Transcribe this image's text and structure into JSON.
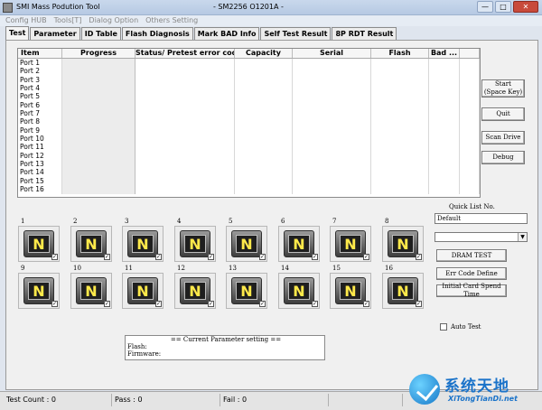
{
  "window": {
    "title": "SMI Mass Podution Tool",
    "center_title": "- SM2256 O1201A -",
    "minimize": "—",
    "maximize": "□",
    "close": "✕"
  },
  "menu": [
    "Config HUB",
    "Tools[T]",
    "Dialog Option",
    "Others Setting"
  ],
  "tabs": [
    "Test",
    "Parameter",
    "ID Table",
    "Flash Diagnosis",
    "Mark BAD Info",
    "Self Test Result",
    "8P RDT Result"
  ],
  "table": {
    "headers": [
      "Item",
      "Progress",
      "Status/ Pretest error code",
      "Capacity",
      "Serial",
      "Flash",
      "Bad ..."
    ],
    "rows": [
      "Port 1",
      "Port 2",
      "Port 3",
      "Port 4",
      "Port 5",
      "Port 6",
      "Port 7",
      "Port 8",
      "Port 9",
      "Port 10",
      "Port 11",
      "Port 12",
      "Port 13",
      "Port 14",
      "Port 15",
      "Port 16"
    ]
  },
  "buttons": {
    "start": "Start\n(Space Key)",
    "quit": "Quit",
    "scan_drive": "Scan Drive",
    "debug": "Debug",
    "dram_test": "DRAM TEST",
    "err_code_define": "Err Code Define",
    "initial_card_spend_time": "Initial Card Spend Time"
  },
  "ports": {
    "numbers": [
      "1",
      "2",
      "3",
      "4",
      "5",
      "6",
      "7",
      "8",
      "9",
      "10",
      "11",
      "12",
      "13",
      "14",
      "15",
      "16"
    ],
    "icon_letter": "N",
    "check_mark": "✓"
  },
  "quick_list": {
    "label": "Quick List No.",
    "value": "Default"
  },
  "auto_test_label": "Auto Test",
  "parameter_setting": {
    "header": "== Current Parameter setting ==",
    "flash": "Flash:",
    "firmware": "Firmware:"
  },
  "status_bar": {
    "test_count": "Test Count : 0",
    "pass": "Pass : 0",
    "fail": "Fail : 0"
  },
  "watermark": {
    "text": "系统天地",
    "sub": "XiTongTianDi.net"
  }
}
